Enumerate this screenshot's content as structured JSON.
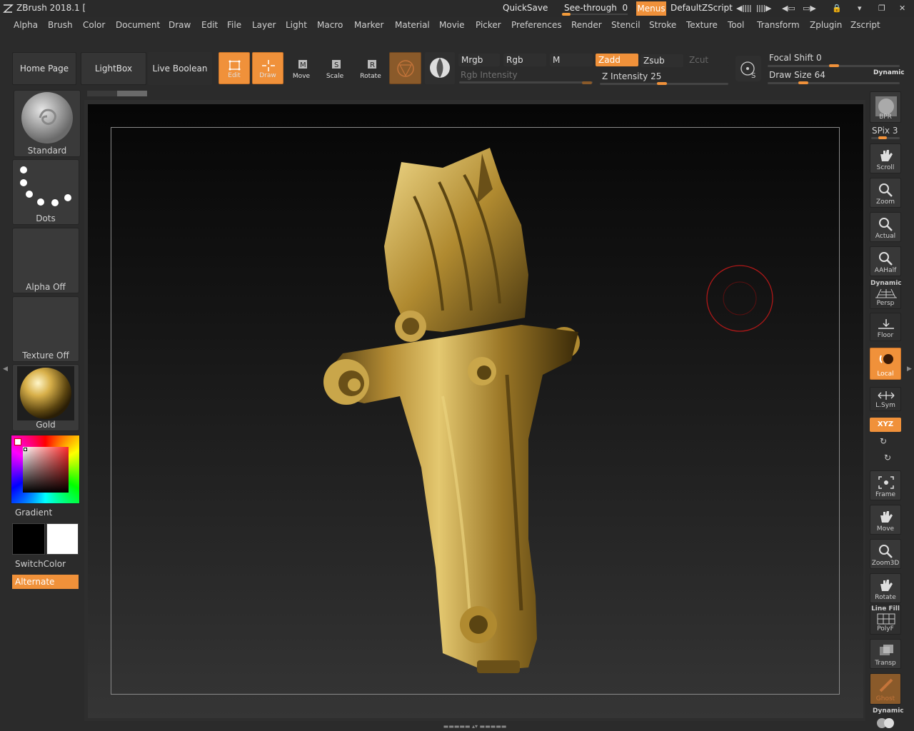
{
  "titlebar": {
    "title": "ZBrush 2018.1 [",
    "quicksave": "QuickSave",
    "see_through_label": "See-through",
    "see_through_value": "0",
    "see_through_level": 0,
    "menus": "Menus",
    "default_zscript": "DefaultZScript"
  },
  "menubar": [
    "Alpha",
    "Brush",
    "Color",
    "Document",
    "Draw",
    "Edit",
    "File",
    "Layer",
    "Light",
    "Macro",
    "Marker",
    "Material",
    "Movie",
    "Picker",
    "Preferences",
    "Render",
    "Stencil",
    "Stroke",
    "Texture",
    "Tool",
    "Transform",
    "Zplugin",
    "Zscript"
  ],
  "shelf": {
    "home_page": "Home Page",
    "lightbox": "LightBox",
    "live_boolean": "Live Boolean",
    "edit": "Edit",
    "draw": "Draw",
    "move": "Move",
    "scale": "Scale",
    "rotate": "Rotate",
    "mrgb": "Mrgb",
    "rgb": "Rgb",
    "m": "M",
    "zadd": "Zadd",
    "zsub": "Zsub",
    "zcut": "Zcut",
    "rgb_intensity": "Rgb Intensity",
    "z_intensity_label": "Z Intensity",
    "z_intensity_value": "25",
    "focal_shift_label": "Focal Shift",
    "focal_shift_value": "0",
    "draw_size_label": "Draw Size",
    "draw_size_value": "64",
    "dynamic": "Dynamic"
  },
  "left_tray": {
    "brush": "Standard",
    "stroke": "Dots",
    "alpha": "Alpha Off",
    "texture": "Texture Off",
    "material": "Gold",
    "gradient": "Gradient",
    "switch_color": "SwitchColor",
    "alternate": "Alternate"
  },
  "right_tray": {
    "bpr": "BPR",
    "spix_label": "SPix",
    "spix_value": "3",
    "scroll": "Scroll",
    "zoom": "Zoom",
    "actual": "Actual",
    "aahalf": "AAHalf",
    "dynamic_persp": "Dynamic",
    "persp": "Persp",
    "floor": "Floor",
    "local": "Local",
    "lsym": "L.Sym",
    "xyz": "XYZ",
    "frame": "Frame",
    "move": "Move",
    "zoom3d": "Zoom3D",
    "rotate": "Rotate",
    "line_fill": "Line Fill",
    "polyf": "PolyF",
    "transp": "Transp",
    "ghost": "Ghost",
    "dynamic_bottom": "Dynamic"
  },
  "colors": {
    "accent": "#f0913a",
    "background": "#2b2b2b",
    "gold": "#c9a64a"
  }
}
